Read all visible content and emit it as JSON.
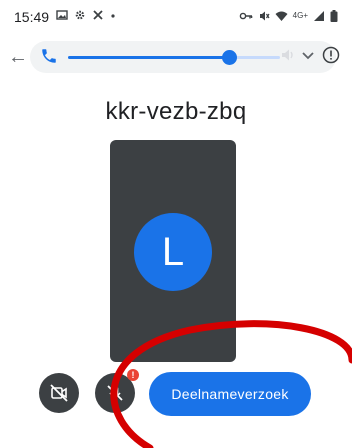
{
  "status_bar": {
    "time": "15:49",
    "left_icons": [
      "image-icon",
      "gear-icon",
      "tools-icon",
      "dot-icon"
    ],
    "right_icons": [
      "key-icon",
      "mute-icon",
      "wifi-icon",
      "signal-icon",
      "battery-icon"
    ],
    "network_label": "4G+"
  },
  "call_controls": {
    "volume_level": 0.76,
    "icons": [
      "back-arrow-icon",
      "phone-icon",
      "speaker-icon",
      "chevron-down-icon",
      "info-icon"
    ]
  },
  "meeting": {
    "code": "kkr-vezb-zbq"
  },
  "preview": {
    "avatar_initial": "L"
  },
  "actions": {
    "join_label": "Deelnameverzoek",
    "mic_alert": "!"
  },
  "colors": {
    "accent": "#1a73e8",
    "tile": "#3c4043",
    "alert": "#ea4335",
    "annotation": "#d50000"
  }
}
